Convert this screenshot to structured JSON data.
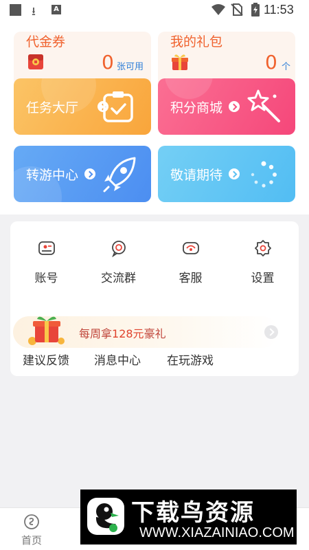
{
  "status_bar": {
    "time": "11:53"
  },
  "summary_cards": [
    {
      "title": "代金券",
      "count": "0",
      "unit": "张可用"
    },
    {
      "title": "我的礼包",
      "count": "0",
      "unit": "个"
    }
  ],
  "tiles": [
    {
      "label": "任务大厅"
    },
    {
      "label": "积分商城"
    },
    {
      "label": "转游中心"
    },
    {
      "label": "敬请期待"
    }
  ],
  "menu": {
    "items": [
      {
        "label": "账号",
        "icon": "account-icon"
      },
      {
        "label": "交流群",
        "icon": "chat-group-icon"
      },
      {
        "label": "客服",
        "icon": "customer-service-icon"
      },
      {
        "label": "设置",
        "icon": "settings-gear-icon"
      }
    ],
    "promo": {
      "prefix": "每周拿",
      "highlight": "128元",
      "suffix": "豪礼"
    },
    "bottom_items": [
      {
        "label": "建议反馈"
      },
      {
        "label": "消息中心"
      },
      {
        "label": "在玩游戏"
      }
    ]
  },
  "bottom_nav": {
    "items": [
      {
        "label": "首页"
      },
      {
        "label": ""
      },
      {
        "label": ""
      },
      {
        "label": ""
      },
      {
        "label": ""
      }
    ]
  },
  "watermark": {
    "title": "下载鸟资源",
    "url": "WWW.XIAZAINIAO.COM"
  },
  "colors": {
    "accent": "#f0622e",
    "task_tile": "#f9a53b",
    "points_tile": "#f5477a",
    "transfer_tile": "#4c8ef1",
    "soon_tile": "#52bdf3"
  }
}
